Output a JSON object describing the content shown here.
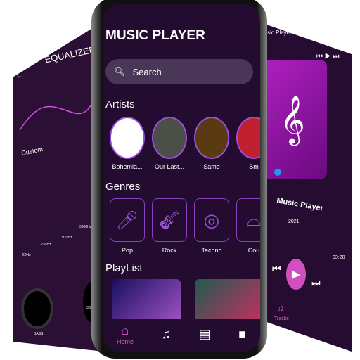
{
  "equalizer": {
    "title": "EQUALIZER",
    "preset": "Custom",
    "bands": [
      "60Hz",
      "230Hz",
      "910Hz",
      "3600Hz"
    ],
    "band_levels": [
      0.2,
      0.55,
      0.15,
      0.8
    ],
    "knobs": [
      "BASS",
      "3D"
    ]
  },
  "main": {
    "title": "MUSIC PLAYER",
    "search_placeholder": "Search",
    "artists_heading": "Artists",
    "artists": [
      "Bohemia...",
      "Our Last...",
      "Same",
      "Sm"
    ],
    "genres_heading": "Genres",
    "genres": [
      {
        "label": "Pop",
        "icon": "microphone-icon"
      },
      {
        "label": "Rock",
        "icon": "guitar-icon"
      },
      {
        "label": "Techno",
        "icon": "turntable-icon"
      },
      {
        "label": "Cou",
        "icon": "hat-icon"
      }
    ],
    "playlist_heading": "PlayList",
    "nav": [
      {
        "label": "Home",
        "icon": "home-icon"
      },
      {
        "label": "",
        "icon": "music-note-icon"
      },
      {
        "label": "",
        "icon": "playlist-icon"
      },
      {
        "label": "",
        "icon": "folder-icon"
      }
    ]
  },
  "player": {
    "header": "Music Player",
    "song_title": "Music Player",
    "year": "2021",
    "duration": "03:20",
    "progress": 0.1,
    "tab_label": "Tracks"
  },
  "colors": {
    "accent": "#e060c8",
    "background": "#240c31",
    "border": "#9b4de0"
  }
}
